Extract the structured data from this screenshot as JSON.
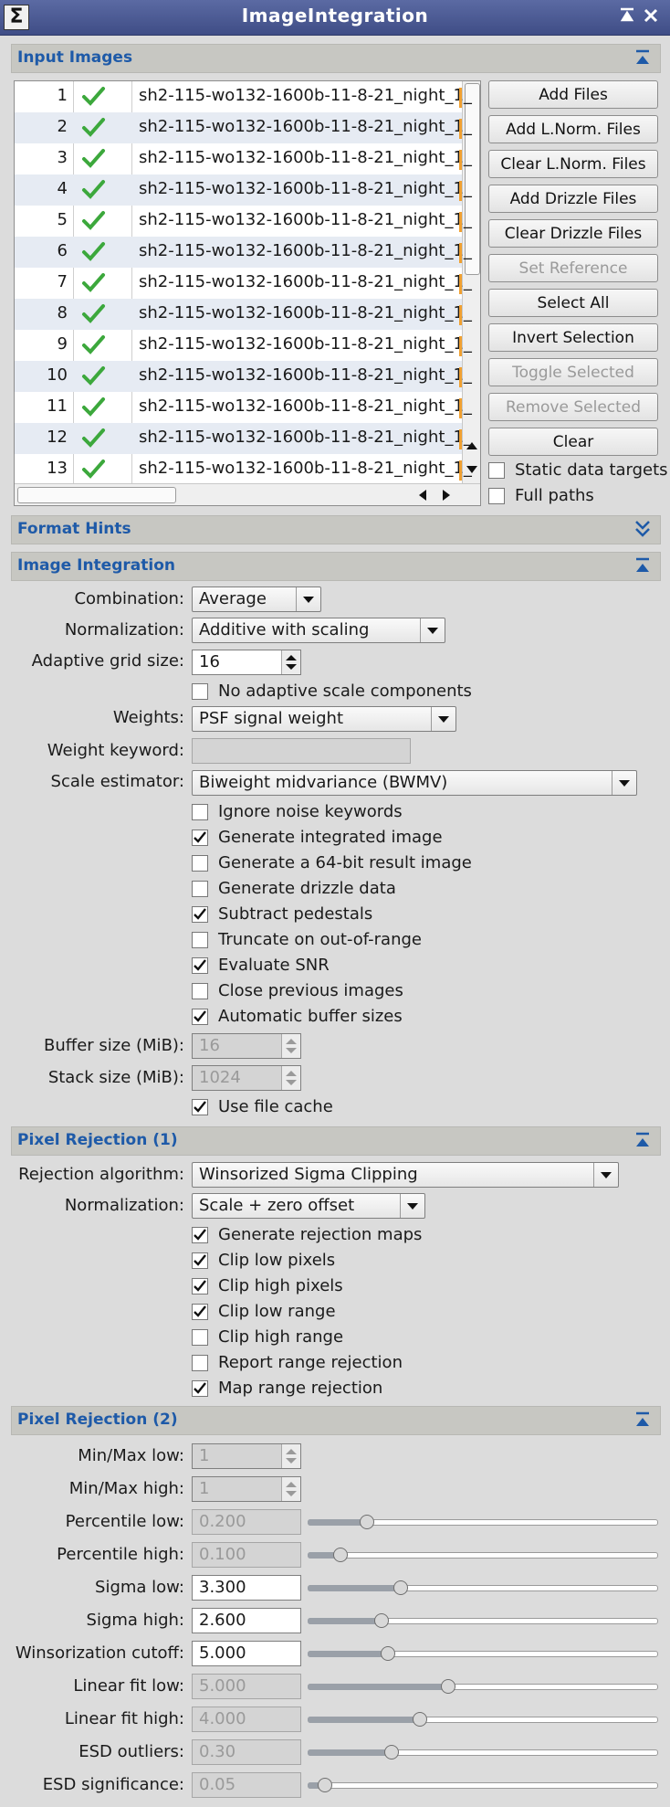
{
  "window": {
    "title": "ImageIntegration"
  },
  "sections": {
    "input_images": "Input Images",
    "format_hints": "Format Hints",
    "image_integration": "Image Integration",
    "pixel_rejection_1": "Pixel Rejection (1)",
    "pixel_rejection_2": "Pixel Rejection (2)"
  },
  "files": [
    {
      "n": "1",
      "name": "sh2-115-wo132-1600b-11-8-21_night_1_"
    },
    {
      "n": "2",
      "name": "sh2-115-wo132-1600b-11-8-21_night_1_"
    },
    {
      "n": "3",
      "name": "sh2-115-wo132-1600b-11-8-21_night_1_"
    },
    {
      "n": "4",
      "name": "sh2-115-wo132-1600b-11-8-21_night_1_"
    },
    {
      "n": "5",
      "name": "sh2-115-wo132-1600b-11-8-21_night_1_"
    },
    {
      "n": "6",
      "name": "sh2-115-wo132-1600b-11-8-21_night_1_"
    },
    {
      "n": "7",
      "name": "sh2-115-wo132-1600b-11-8-21_night_1_"
    },
    {
      "n": "8",
      "name": "sh2-115-wo132-1600b-11-8-21_night_1_"
    },
    {
      "n": "9",
      "name": "sh2-115-wo132-1600b-11-8-21_night_1_"
    },
    {
      "n": "10",
      "name": "sh2-115-wo132-1600b-11-8-21_night_1_"
    },
    {
      "n": "11",
      "name": "sh2-115-wo132-1600b-11-8-21_night_1_"
    },
    {
      "n": "12",
      "name": "sh2-115-wo132-1600b-11-8-21_night_1_"
    },
    {
      "n": "13",
      "name": "sh2-115-wo132-1600b-11-8-21_night_1_"
    }
  ],
  "buttons": [
    {
      "label": "Add Files",
      "enabled": true
    },
    {
      "label": "Add L.Norm. Files",
      "enabled": true
    },
    {
      "label": "Clear L.Norm. Files",
      "enabled": true
    },
    {
      "label": "Add Drizzle Files",
      "enabled": true
    },
    {
      "label": "Clear Drizzle Files",
      "enabled": true
    },
    {
      "label": "Set Reference",
      "enabled": false
    },
    {
      "label": "Select All",
      "enabled": true
    },
    {
      "label": "Invert Selection",
      "enabled": true
    },
    {
      "label": "Toggle Selected",
      "enabled": false
    },
    {
      "label": "Remove Selected",
      "enabled": false
    },
    {
      "label": "Clear",
      "enabled": true
    }
  ],
  "list_options": {
    "static_data_targets": {
      "label": "Static data targets",
      "checked": false
    },
    "full_paths": {
      "label": "Full paths",
      "checked": false
    }
  },
  "integration": {
    "combination": {
      "label": "Combination:",
      "value": "Average"
    },
    "normalization": {
      "label": "Normalization:",
      "value": "Additive with scaling"
    },
    "adaptive_grid": {
      "label": "Adaptive grid size:",
      "value": "16"
    },
    "weights": {
      "label": "Weights:",
      "value": "PSF signal weight"
    },
    "weight_keyword": {
      "label": "Weight keyword:",
      "value": ""
    },
    "scale_estimator": {
      "label": "Scale estimator:",
      "value": "Biweight midvariance (BWMV)"
    },
    "checks": [
      {
        "label": "No adaptive scale components",
        "checked": false
      },
      {
        "label": "Ignore noise keywords",
        "checked": false
      },
      {
        "label": "Generate integrated image",
        "checked": true
      },
      {
        "label": "Generate a 64-bit result image",
        "checked": false
      },
      {
        "label": "Generate drizzle data",
        "checked": false
      },
      {
        "label": "Subtract pedestals",
        "checked": true
      },
      {
        "label": "Truncate on out-of-range",
        "checked": false
      },
      {
        "label": "Evaluate SNR",
        "checked": true
      },
      {
        "label": "Close previous images",
        "checked": false
      },
      {
        "label": "Automatic buffer sizes",
        "checked": true
      },
      {
        "label": "Use file cache",
        "checked": true
      }
    ],
    "buffer_size": {
      "label": "Buffer size (MiB):",
      "value": "16"
    },
    "stack_size": {
      "label": "Stack size (MiB):",
      "value": "1024"
    }
  },
  "rejection1": {
    "algorithm": {
      "label": "Rejection algorithm:",
      "value": "Winsorized Sigma Clipping"
    },
    "normalization": {
      "label": "Normalization:",
      "value": "Scale + zero offset"
    },
    "checks": [
      {
        "label": "Generate rejection maps",
        "checked": true
      },
      {
        "label": "Clip low pixels",
        "checked": true
      },
      {
        "label": "Clip high pixels",
        "checked": true
      },
      {
        "label": "Clip low range",
        "checked": true
      },
      {
        "label": "Clip high range",
        "checked": false
      },
      {
        "label": "Report range rejection",
        "checked": false
      },
      {
        "label": "Map range rejection",
        "checked": true
      }
    ]
  },
  "rejection2": {
    "minmax_low": {
      "label": "Min/Max low:",
      "value": "1"
    },
    "minmax_high": {
      "label": "Min/Max high:",
      "value": "1"
    },
    "params": [
      {
        "label": "Percentile low:",
        "value": "0.200",
        "enabled": false,
        "level": 0.17
      },
      {
        "label": "Percentile high:",
        "value": "0.100",
        "enabled": false,
        "level": 0.095
      },
      {
        "label": "Sigma low:",
        "value": "3.300",
        "enabled": true,
        "level": 0.265
      },
      {
        "label": "Sigma high:",
        "value": "2.600",
        "enabled": true,
        "level": 0.21
      },
      {
        "label": "Winsorization cutoff:",
        "value": "5.000",
        "enabled": true,
        "level": 0.23
      },
      {
        "label": "Linear fit low:",
        "value": "5.000",
        "enabled": false,
        "level": 0.4
      },
      {
        "label": "Linear fit high:",
        "value": "4.000",
        "enabled": false,
        "level": 0.32
      },
      {
        "label": "ESD outliers:",
        "value": "0.30",
        "enabled": false,
        "level": 0.24
      },
      {
        "label": "ESD significance:",
        "value": "0.05",
        "enabled": false,
        "level": 0.05
      }
    ]
  }
}
